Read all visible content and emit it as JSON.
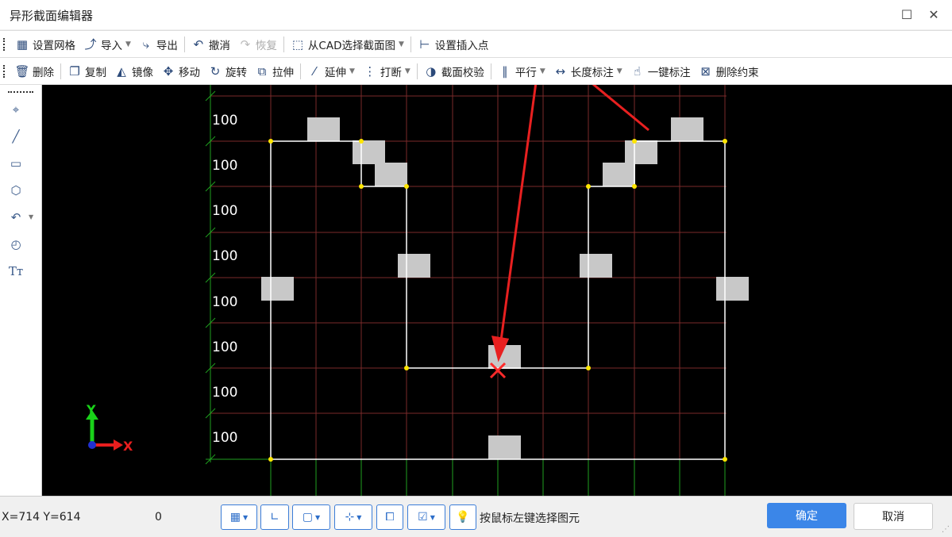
{
  "window": {
    "title": "异形截面编辑器"
  },
  "toolbar1": {
    "grid": "设置网格",
    "import": "导入",
    "export": "导出",
    "undo": "撤消",
    "redo": "恢复",
    "from_cad": "从CAD选择截面图",
    "insert_point": "设置插入点"
  },
  "toolbar2": {
    "delete": "删除",
    "copy": "复制",
    "mirror": "镜像",
    "move": "移动",
    "rotate": "旋转",
    "stretch": "拉伸",
    "extend": "延伸",
    "break": "打断",
    "check": "截面校验",
    "parallel": "平行",
    "length_dim": "长度标注",
    "auto_dim": "一键标注",
    "delete_constraint": "删除约束"
  },
  "canvas": {
    "row_labels": [
      "100",
      "100",
      "100",
      "100",
      "100",
      "100",
      "100",
      "100"
    ],
    "axis_x": "X",
    "axis_y": "Y"
  },
  "status": {
    "coords": "X=714 Y=614",
    "value": "0",
    "hint": "按鼠标左键选择图元",
    "ok": "确定",
    "cancel": "取消"
  },
  "colors": {
    "accent": "#3b86e8",
    "grid_green": "#1fa01f",
    "grid_red": "#7a2a2a",
    "annotation_arrow": "#e82020"
  }
}
